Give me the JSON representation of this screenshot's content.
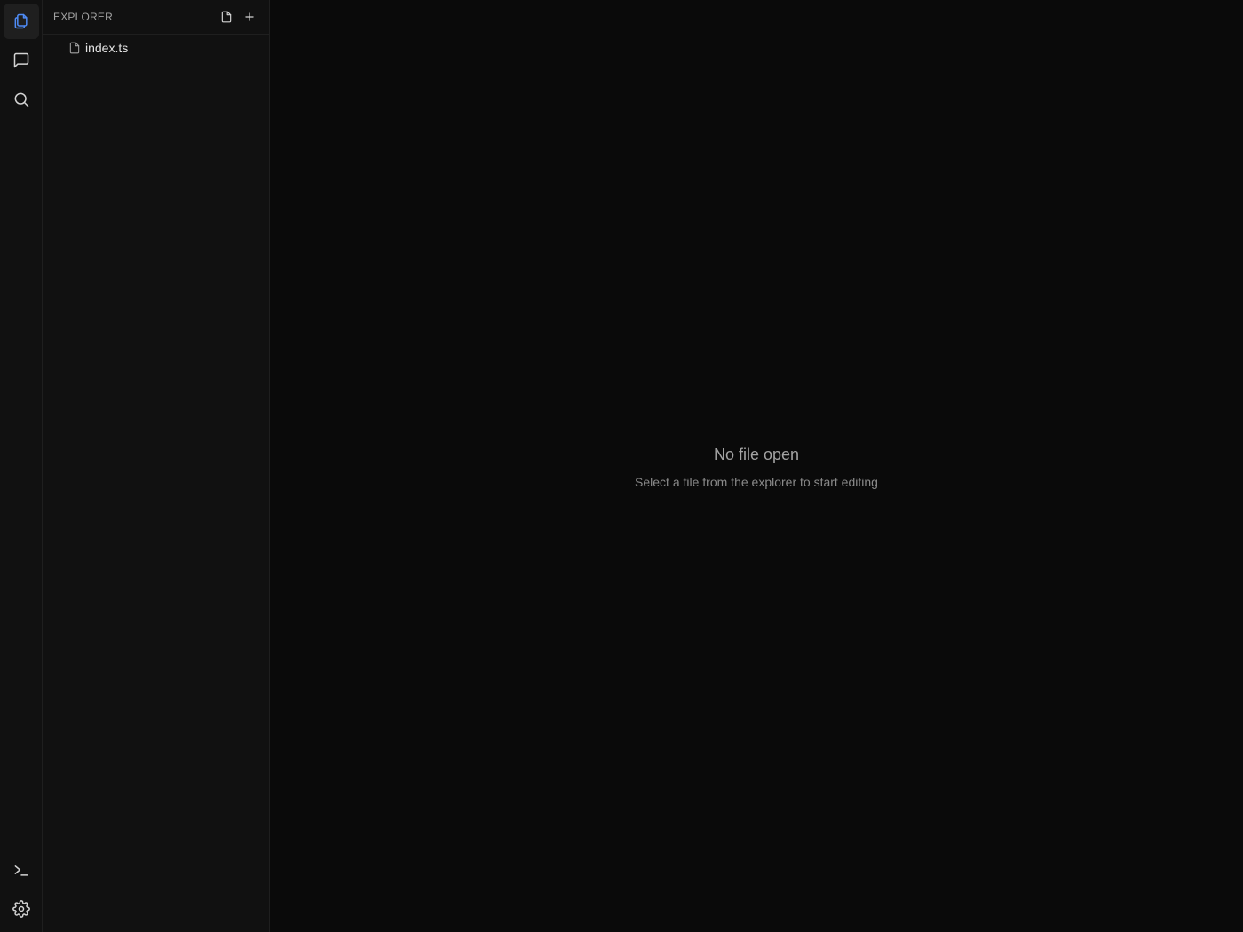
{
  "activity_bar": {
    "top_items": [
      {
        "icon": "files-icon",
        "active": true
      },
      {
        "icon": "chat-icon",
        "active": false
      },
      {
        "icon": "search-icon",
        "active": false
      }
    ],
    "bottom_items": [
      {
        "icon": "terminal-icon"
      },
      {
        "icon": "gear-icon"
      }
    ],
    "accent_color": "#4f8cf7"
  },
  "sidebar": {
    "title": "EXPLORER",
    "actions": [
      {
        "icon": "new-file-icon"
      },
      {
        "icon": "plus-icon"
      }
    ],
    "files": [
      {
        "name": "index.ts",
        "icon": "file-icon"
      }
    ]
  },
  "editor": {
    "empty_title": "No file open",
    "empty_subtitle": "Select a file from the explorer to start editing"
  }
}
